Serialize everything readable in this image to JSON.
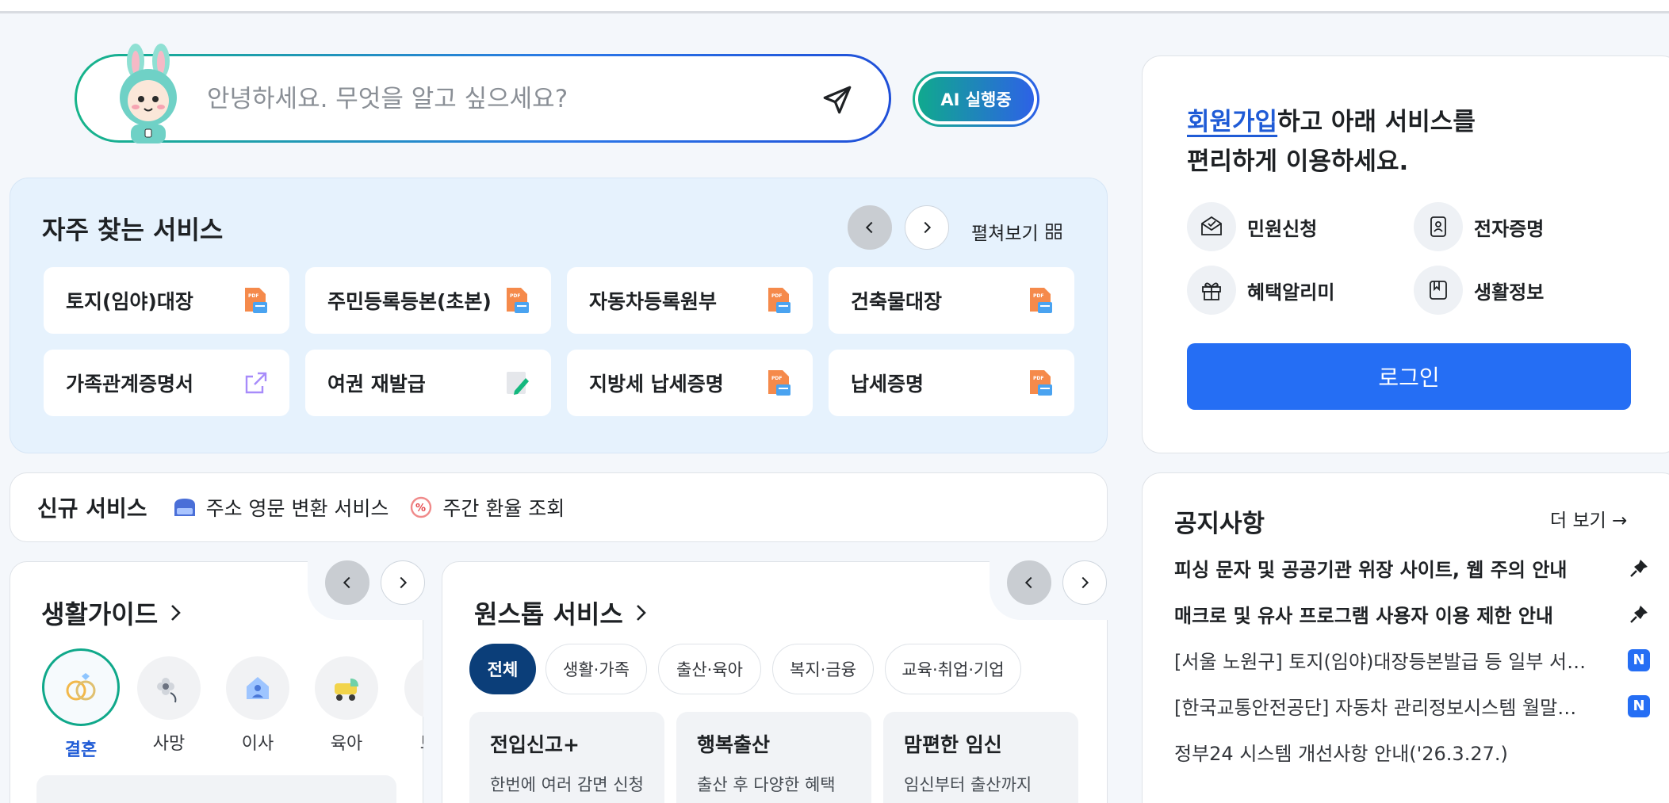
{
  "search": {
    "placeholder": "안녕하세요. 무엇을 알고 싶으세요?",
    "ai_button": "AI 실행중"
  },
  "frequent": {
    "title": "자주 찾는 서비스",
    "expand_label": "펼쳐보기",
    "items": [
      {
        "label": "토지(임야)대장",
        "icon": "pdf-icon"
      },
      {
        "label": "주민등록등본(초본)",
        "icon": "pdf-icon"
      },
      {
        "label": "자동차등록원부",
        "icon": "pdf-icon"
      },
      {
        "label": "건축물대장",
        "icon": "pdf-icon"
      },
      {
        "label": "가족관계증명서",
        "icon": "external-link-icon"
      },
      {
        "label": "여권 재발급",
        "icon": "edit-document-icon"
      },
      {
        "label": "지방세 납세증명",
        "icon": "pdf-icon"
      },
      {
        "label": "납세증명",
        "icon": "pdf-icon"
      }
    ]
  },
  "new_services": {
    "title": "신규 서비스",
    "items": [
      {
        "label": "주소 영문 변환 서비스",
        "icon": "mailbox-icon"
      },
      {
        "label": "주간 환율 조회",
        "icon": "exchange-rate-icon"
      }
    ]
  },
  "life_guide": {
    "title": "생활가이드",
    "categories": [
      {
        "label": "결혼",
        "icon": "rings-icon",
        "active": true
      },
      {
        "label": "사망",
        "icon": "flower-icon"
      },
      {
        "label": "이사",
        "icon": "house-icon"
      },
      {
        "label": "육아",
        "icon": "stroller-icon"
      },
      {
        "label": "보건",
        "icon": "health-icon"
      }
    ]
  },
  "one_stop": {
    "title": "원스톱 서비스",
    "chips": [
      "전체",
      "생활·가족",
      "출산·육아",
      "복지·금융",
      "교육·취업·기업"
    ],
    "cards": [
      {
        "title": "전입신고+",
        "desc": "한번에 여러 감면 신청"
      },
      {
        "title": "행복출산",
        "desc": "출산 후 다양한 혜택"
      },
      {
        "title": "맘편한 임신",
        "desc": "임신부터 출산까지"
      }
    ]
  },
  "member": {
    "link": "회원가입",
    "line1_rest": "하고 아래 서비스를",
    "line2": "편리하게 이용하세요.",
    "quick": [
      {
        "label": "민원신청",
        "icon": "mail-check-icon"
      },
      {
        "label": "전자증명",
        "icon": "id-card-icon"
      },
      {
        "label": "혜택알리미",
        "icon": "gift-icon"
      },
      {
        "label": "생활정보",
        "icon": "bookmark-icon"
      }
    ],
    "login": "로그인"
  },
  "notices": {
    "title": "공지사항",
    "more": "더 보기 →",
    "items": [
      {
        "text": "피싱 문자 및 공공기관 위장 사이트, 웹 주의 안내",
        "pinned": true
      },
      {
        "text": "매크로 및 유사 프로그램 사용자 이용 제한 안내",
        "pinned": true
      },
      {
        "text": "[서울 노원구] 토지(임야)대장등본발급 등 일부 서…",
        "badge": "N"
      },
      {
        "text": "[한국교통안전공단] 자동차 관리정보시스템 월말…",
        "badge": "N"
      },
      {
        "text": "정부24 시스템 개선사항 안내('26.3.27.)"
      }
    ]
  },
  "colors": {
    "accent": "#256ef4",
    "teal": "#0fa88a",
    "active_chip": "#0b3e79",
    "panel_bg": "#e6f2fd"
  }
}
